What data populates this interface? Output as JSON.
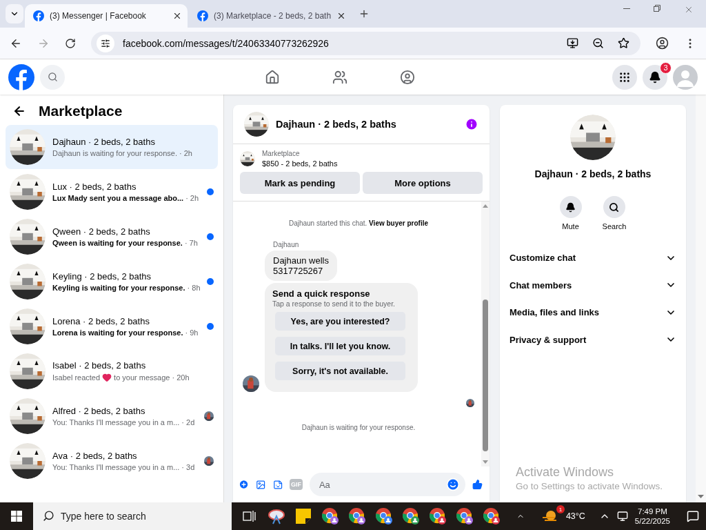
{
  "browser": {
    "tabs": [
      {
        "title": "(3) Messenger | Facebook",
        "selected": true
      },
      {
        "title": "(3) Marketplace - 2 beds, 2 bath",
        "selected": false
      }
    ],
    "url": "facebook.com/messages/t/24063340773262926"
  },
  "header": {
    "notification_count": "3"
  },
  "sidebar": {
    "title": "Marketplace",
    "conversations": [
      {
        "name": "Dajhaun · 2 beds, 2 baths",
        "preview": "Dajhaun is waiting for your response.",
        "time": "· 2h",
        "selected": true,
        "unread": false
      },
      {
        "name": "Lux · 2 beds, 2 baths",
        "preview": "Lux Mady sent you a message abo...",
        "time": "· 2h",
        "selected": false,
        "unread": true
      },
      {
        "name": "Qween · 2 beds, 2 baths",
        "preview": "Qween is waiting for your response.",
        "time": "· 7h",
        "selected": false,
        "unread": true
      },
      {
        "name": "Keyling · 2 beds, 2 baths",
        "preview": "Keyling is waiting for your response.",
        "time": "· 8h",
        "selected": false,
        "unread": true
      },
      {
        "name": "Lorena · 2 beds, 2 baths",
        "preview": "Lorena is waiting for your response.",
        "time": "· 9h",
        "selected": false,
        "unread": true
      },
      {
        "name": "Isabel · 2 beds, 2 baths",
        "preview": "Isabel reacted",
        "preview_end": "to your message",
        "time": "· 20h",
        "selected": false,
        "unread": false,
        "reaction": true
      },
      {
        "name": "Alfred · 2 beds, 2 baths",
        "preview": "You: Thanks I'll message you in a m...",
        "time": "· 2d",
        "selected": false,
        "unread": false,
        "seen": true
      },
      {
        "name": "Ava · 2 beds, 2 baths",
        "preview": "You: Thanks I'll message you in a m...",
        "time": "· 3d",
        "selected": false,
        "unread": false,
        "seen": true
      }
    ]
  },
  "chat": {
    "title": "Dajhaun · 2 beds, 2 baths",
    "listing": {
      "source": "Marketplace",
      "summary": "$850 - 2 beds, 2 baths"
    },
    "actions": [
      "Mark as pending",
      "More options"
    ],
    "started": {
      "text": "Dajhaun started this chat.",
      "link": "View buyer profile"
    },
    "sender": "Dajhaun",
    "message_lines": [
      "Dajhaun wells",
      "5317725267"
    ],
    "quick": {
      "title": "Send a quick response",
      "hint": "Tap a response to send it to the buyer.",
      "options": [
        "Yes, are you interested?",
        "In talks. I'll let you know.",
        "Sorry, it's not available."
      ]
    },
    "status": "Dajhaun is waiting for your response.",
    "composer": {
      "placeholder": "Aa",
      "gif": "GIF"
    }
  },
  "details": {
    "title": "Dajhaun · 2 beds, 2 baths",
    "actions": [
      {
        "kind": "mute",
        "label": "Mute"
      },
      {
        "kind": "search",
        "label": "Search"
      }
    ],
    "sections": [
      {
        "label": "Customize chat",
        "expanded": false
      },
      {
        "label": "Chat members",
        "expanded": false
      },
      {
        "label": "Media, files and links",
        "expanded": false
      },
      {
        "label": "Privacy & support",
        "expanded": false
      }
    ]
  },
  "activation": {
    "title": "Activate Windows",
    "text": "Go to Settings to activate Windows."
  },
  "taskbar": {
    "search_placeholder": "Type here to search",
    "weather_badge": "1",
    "temperature": "43°C",
    "time": "7:49 PM",
    "date": "5/22/2025",
    "apps": [
      {
        "kind": "snip"
      },
      {
        "kind": "notes"
      },
      {
        "kind": "chrome",
        "color": "#a56be0"
      },
      {
        "kind": "chrome",
        "color": "#a56be0"
      },
      {
        "kind": "chrome",
        "color": "#3b82f6"
      },
      {
        "kind": "chrome",
        "color": "#2f9e57"
      },
      {
        "kind": "chrome",
        "color": "#e0364c"
      },
      {
        "kind": "chrome",
        "color": "#a56be0"
      },
      {
        "kind": "chrome",
        "color": "#e0364c"
      }
    ]
  }
}
